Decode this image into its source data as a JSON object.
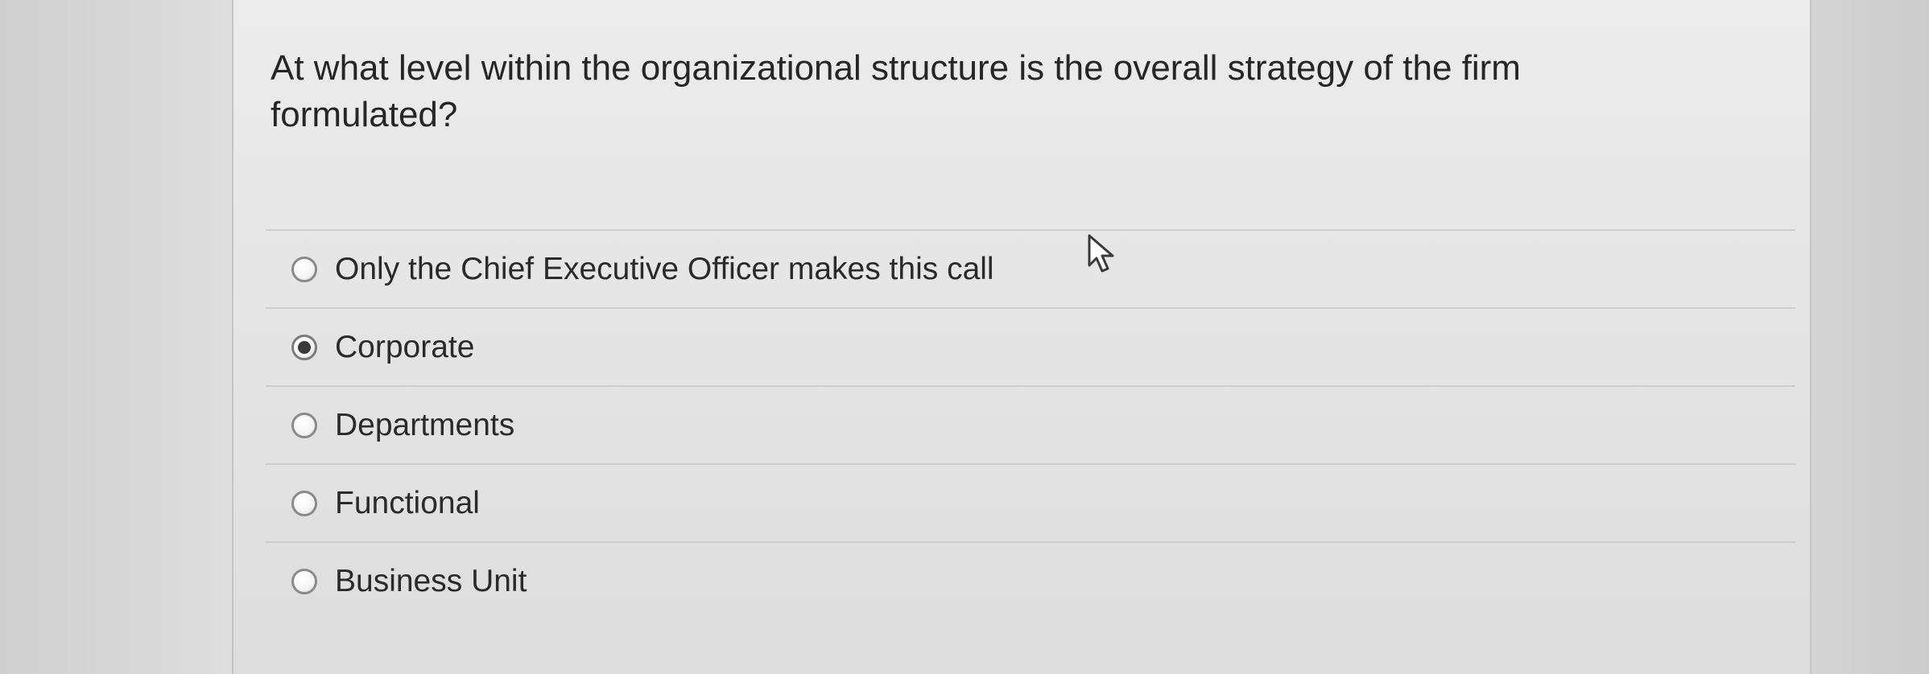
{
  "question": {
    "text": "At what level within the organizational structure is the overall strategy of the firm formulated?"
  },
  "options": [
    {
      "label": "Only the Chief Executive Officer makes this call",
      "selected": false
    },
    {
      "label": "Corporate",
      "selected": true
    },
    {
      "label": "Departments",
      "selected": false
    },
    {
      "label": "Functional",
      "selected": false
    },
    {
      "label": "Business Unit",
      "selected": false
    }
  ],
  "cursor": {
    "icon": "mouse-pointer-icon"
  }
}
